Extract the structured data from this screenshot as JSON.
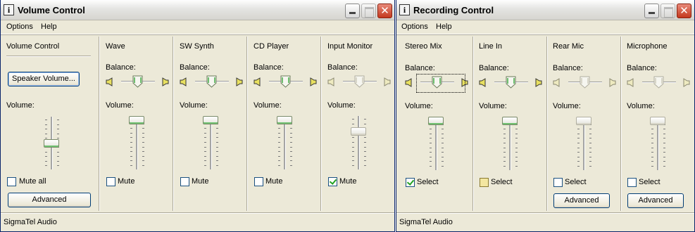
{
  "volume_window": {
    "title": "Volume Control",
    "menus": [
      "Options",
      "Help"
    ],
    "status": "SigmaTel Audio",
    "master": {
      "title": "Volume Control",
      "button": "Speaker Volume...",
      "volume_label": "Volume:",
      "mute_label": "Mute all",
      "mute_checked": false,
      "volume_level": 0.5,
      "advanced_label": "Advanced"
    },
    "channels": [
      {
        "title": "Wave",
        "balance_label": "Balance:",
        "volume_label": "Volume:",
        "mute_label": "Mute",
        "mute_checked": false,
        "volume_level": 1.0,
        "enabled": true
      },
      {
        "title": "SW Synth",
        "balance_label": "Balance:",
        "volume_label": "Volume:",
        "mute_label": "Mute",
        "mute_checked": false,
        "volume_level": 1.0,
        "enabled": true
      },
      {
        "title": "CD Player",
        "balance_label": "Balance:",
        "volume_label": "Volume:",
        "mute_label": "Mute",
        "mute_checked": false,
        "volume_level": 1.0,
        "enabled": true
      },
      {
        "title": "Input Monitor",
        "balance_label": "Balance:",
        "volume_label": "Volume:",
        "mute_label": "Mute",
        "mute_checked": true,
        "volume_level": 0.75,
        "enabled": false
      }
    ]
  },
  "recording_window": {
    "title": "Recording Control",
    "menus": [
      "Options",
      "Help"
    ],
    "status": "SigmaTel Audio",
    "channels": [
      {
        "title": "Stereo Mix",
        "balance_label": "Balance:",
        "volume_label": "Volume:",
        "select_label": "Select",
        "select_checked": true,
        "volume_level": 1.0,
        "enabled": true
      },
      {
        "title": "Line In",
        "balance_label": "Balance:",
        "volume_label": "Volume:",
        "select_label": "Select",
        "select_checked": false,
        "volume_level": 1.0,
        "enabled": true
      },
      {
        "title": "Rear Mic",
        "balance_label": "Balance:",
        "volume_label": "Volume:",
        "select_label": "Select",
        "select_checked": false,
        "volume_level": 1.0,
        "enabled": false,
        "advanced_label": "Advanced"
      },
      {
        "title": "Microphone",
        "balance_label": "Balance:",
        "volume_label": "Volume:",
        "select_label": "Select",
        "select_checked": false,
        "volume_level": 1.0,
        "enabled": false,
        "advanced_label": "Advanced"
      }
    ]
  },
  "colors": {
    "window_bg": "#ece9d8",
    "slider_accent": "#6fc06f",
    "check_mark": "#21a121",
    "close_button": "#c4381e"
  },
  "icons": [
    "app-icon",
    "minimize-icon",
    "maximize-icon",
    "close-icon",
    "speaker-left-icon",
    "speaker-right-icon"
  ]
}
